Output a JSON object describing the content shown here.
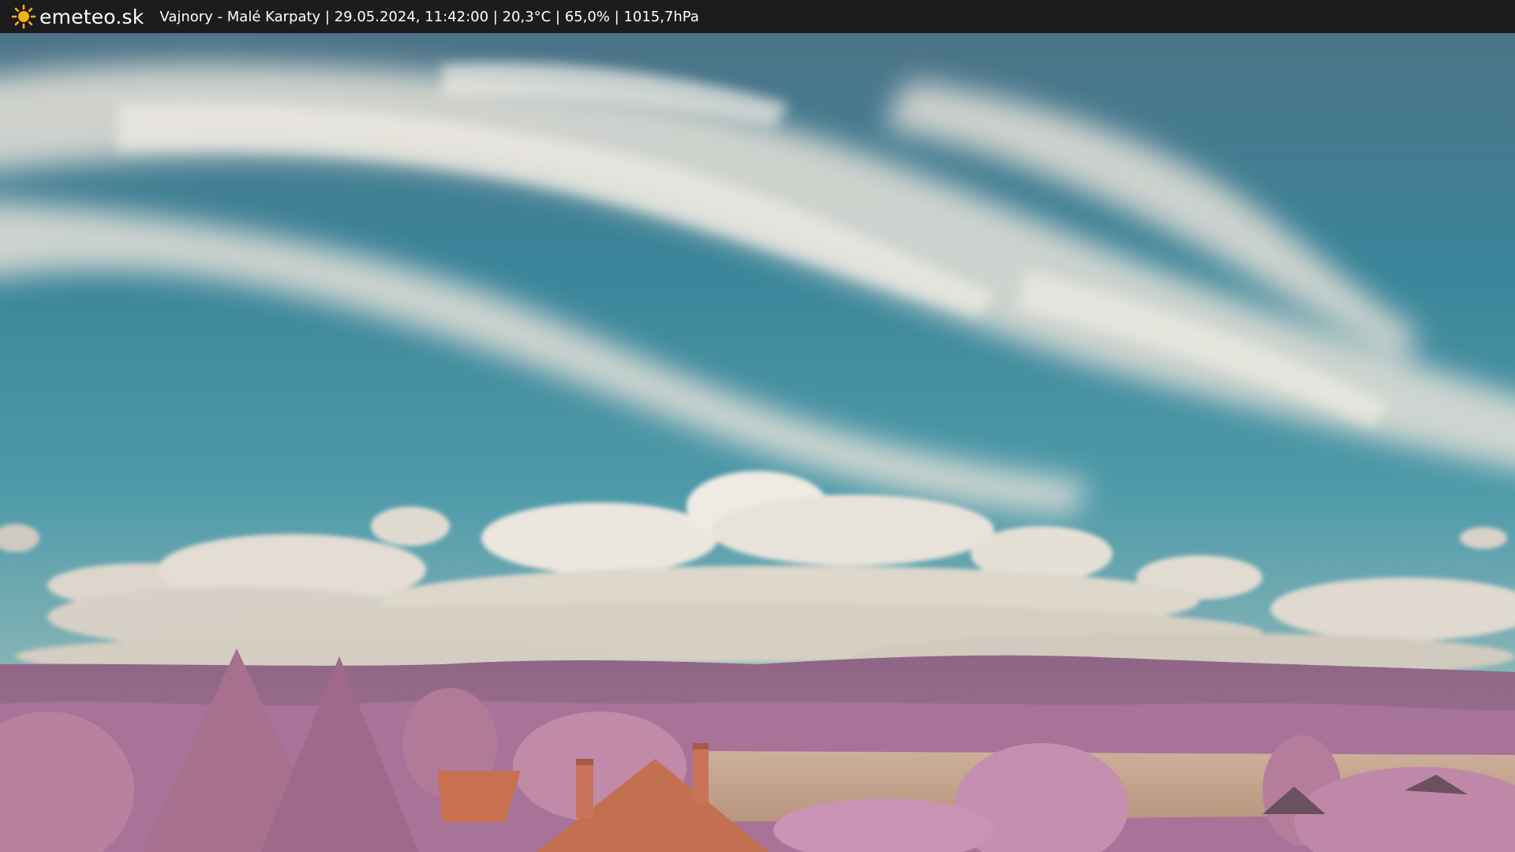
{
  "header": {
    "brand": "emeteo.sk",
    "status_line": "Vajnory - Malé Karpaty | 29.05.2024, 11:42:00 | 20,3°C | 65,0% | 1015,7hPa",
    "logo_icon": "sun-icon"
  },
  "colors": {
    "bar_background": "#1c1c1c",
    "sun": "#f2b01e",
    "sky_top": "#3e6f86",
    "sky_mid": "#3b8aa0",
    "sky_horizon": "#7ab0b6",
    "cloud": "#e4dfd6",
    "hills": "#9a6b8d",
    "foliage": "#c48fb2",
    "field": "#c9a78f",
    "roof": "#c86f4f"
  }
}
